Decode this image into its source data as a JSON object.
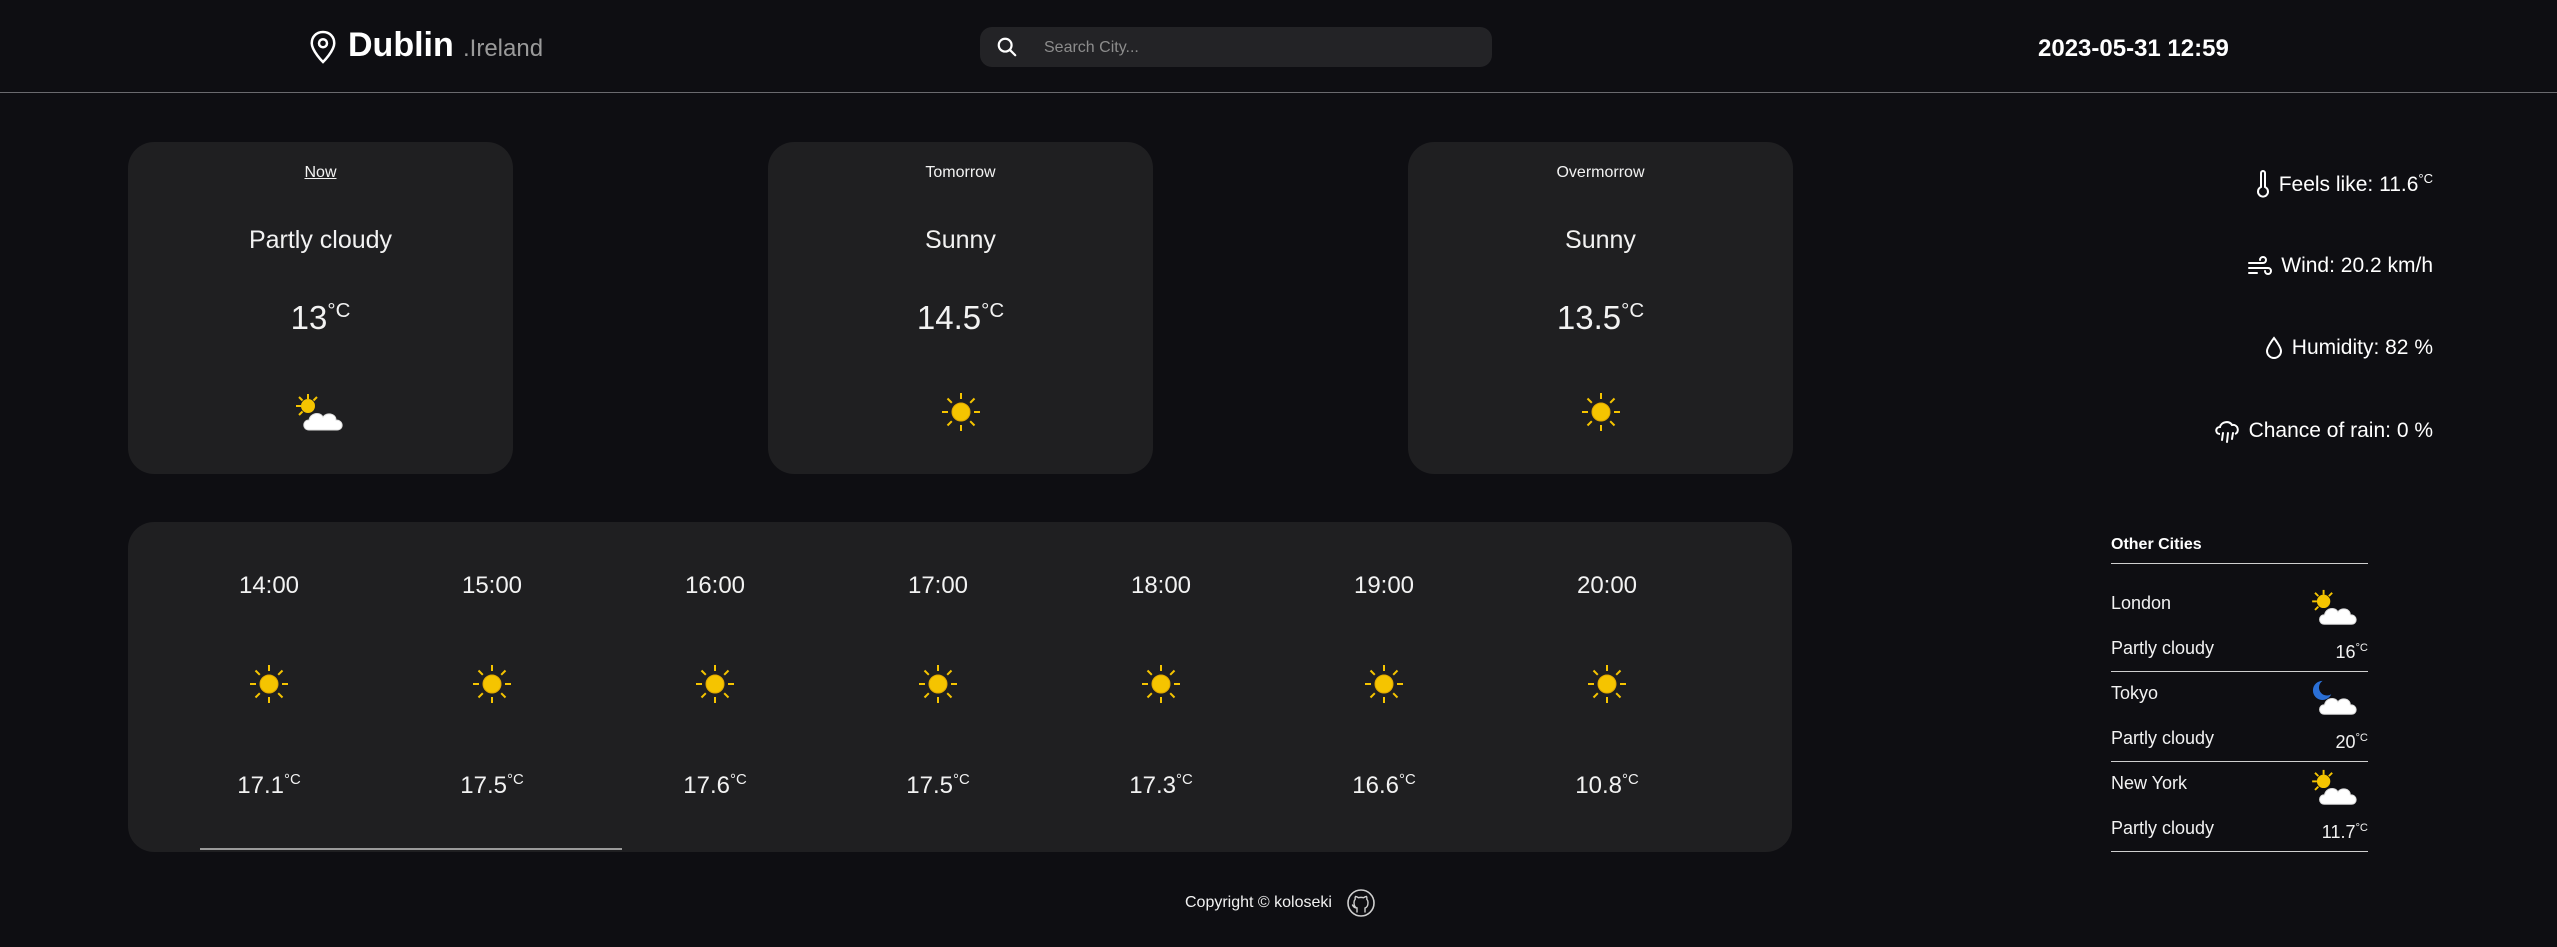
{
  "header": {
    "city": "Dublin",
    "country": ".Ireland",
    "search_placeholder": "Search City...",
    "datetime": "2023-05-31 12:59"
  },
  "days": [
    {
      "label": "Now",
      "condition": "Partly cloudy",
      "temp": "13",
      "unit": "°C",
      "icon": "partly-cloudy-icon",
      "active": true
    },
    {
      "label": "Tomorrow",
      "condition": "Sunny",
      "temp": "14.5",
      "unit": "°C",
      "icon": "sun-icon",
      "active": false
    },
    {
      "label": "Overmorrow",
      "condition": "Sunny",
      "temp": "13.5",
      "unit": "°C",
      "icon": "sun-icon",
      "active": false
    }
  ],
  "details": {
    "feels_like": "Feels like: 11.6",
    "feels_unit": "°C",
    "wind": "Wind: 20.2 km/h",
    "humidity": "Humidity: 82 %",
    "rain": "Chance of rain: 0 %"
  },
  "hourly": [
    {
      "time": "14:00",
      "temp": "17.1",
      "unit": "°C"
    },
    {
      "time": "15:00",
      "temp": "17.5",
      "unit": "°C"
    },
    {
      "time": "16:00",
      "temp": "17.6",
      "unit": "°C"
    },
    {
      "time": "17:00",
      "temp": "17.5",
      "unit": "°C"
    },
    {
      "time": "18:00",
      "temp": "17.3",
      "unit": "°C"
    },
    {
      "time": "19:00",
      "temp": "16.6",
      "unit": "°C"
    },
    {
      "time": "20:00",
      "temp": "10.8",
      "unit": "°C"
    }
  ],
  "other_cities": {
    "title": "Other Cities",
    "items": [
      {
        "name": "London",
        "condition": "Partly cloudy",
        "temp": "16",
        "unit": "°C",
        "icon": "partly-cloudy-icon"
      },
      {
        "name": "Tokyo",
        "condition": "Partly cloudy",
        "temp": "20",
        "unit": "°C",
        "icon": "partly-cloudy-night-icon"
      },
      {
        "name": "New York",
        "condition": "Partly cloudy",
        "temp": "11.7",
        "unit": "°C",
        "icon": "partly-cloudy-icon"
      }
    ]
  },
  "footer": {
    "copyright": "Copyright © koloseki"
  },
  "colors": {
    "background": "#0e0e12",
    "card": "#1f1f21",
    "sun": "#f5c400",
    "cloud": "#ffffff"
  }
}
